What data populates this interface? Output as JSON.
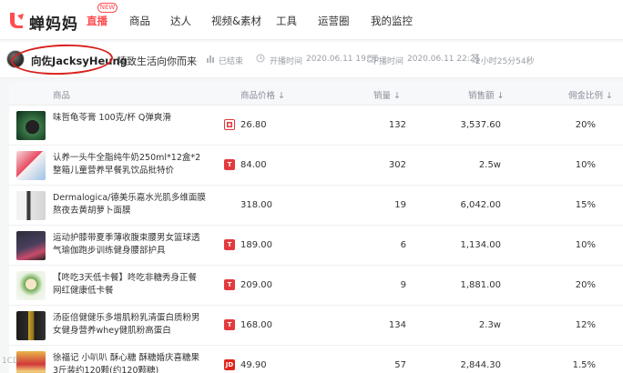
{
  "brand": {
    "name": "蝉妈妈",
    "color": "#ff4d4f"
  },
  "nav": {
    "items": [
      {
        "label": "直播",
        "active": true,
        "badge": "NEW"
      },
      {
        "label": "商品"
      },
      {
        "label": "达人"
      },
      {
        "label": "视频&素材"
      },
      {
        "label": "工具"
      },
      {
        "label": "运营圈"
      },
      {
        "label": "我的监控"
      }
    ]
  },
  "live": {
    "anchor": "向佐JacksyHeung",
    "title": "精致生活向你而来",
    "status": "已结束",
    "start_label": "开播时间",
    "start_time": "2020.06.11 19:55",
    "end_label": "下播时间",
    "end_time": "2020.06.11 22:21",
    "duration": "2小时25分54秒"
  },
  "table": {
    "headers": {
      "product": "商品",
      "price": "商品价格 ↓",
      "sales": "销量 ↓",
      "amount": "销售额 ↓",
      "rate": "佣金比例 ↓"
    },
    "rows": [
      {
        "name": "味哲龟苓膏 100克/杯 Q弹爽滑",
        "platform": "pdd",
        "price": "26.80",
        "sales": "132",
        "amount": "3,537.60",
        "rate": "20%"
      },
      {
        "name": "认养一头牛全脂纯牛奶250ml*12盒*2整箱儿童营养早餐乳饮品批特价",
        "platform": "tmall",
        "price": "84.00",
        "sales": "302",
        "amount": "2.5w",
        "rate": "10%"
      },
      {
        "name": "Dermalogica/德美乐嘉水光肌多维面膜 熬夜去黄胡萝卜面膜",
        "platform": "",
        "price": "318.00",
        "sales": "19",
        "amount": "6,042.00",
        "rate": "15%"
      },
      {
        "name": "运动护膝带夏季薄收腹束腰男女篮球透气瑜伽跑步训练健身腰部护具",
        "platform": "tmall",
        "price": "189.00",
        "sales": "6",
        "amount": "1,134.00",
        "rate": "10%"
      },
      {
        "name": "【咚吃3天低卡餐】咚吃非糖秀身正餐 网红健康低卡餐",
        "platform": "tmall",
        "price": "209.00",
        "sales": "9",
        "amount": "1,881.00",
        "rate": "20%"
      },
      {
        "name": "汤臣倍健健乐多增肌粉乳清蛋白质粉男女健身营养whey健肌粉高蛋白",
        "platform": "tmall",
        "price": "168.00",
        "sales": "134",
        "amount": "2.3w",
        "rate": "12%"
      },
      {
        "name": "徐福记 小叭叭 酥心糖 酥糖婚庆喜糖果 3斤装约120颗(约120颗糖)",
        "platform": "jd",
        "price": "49.90",
        "sales": "57",
        "amount": "2,844.30",
        "rate": "1.5%"
      }
    ]
  },
  "watermark": "1CD"
}
